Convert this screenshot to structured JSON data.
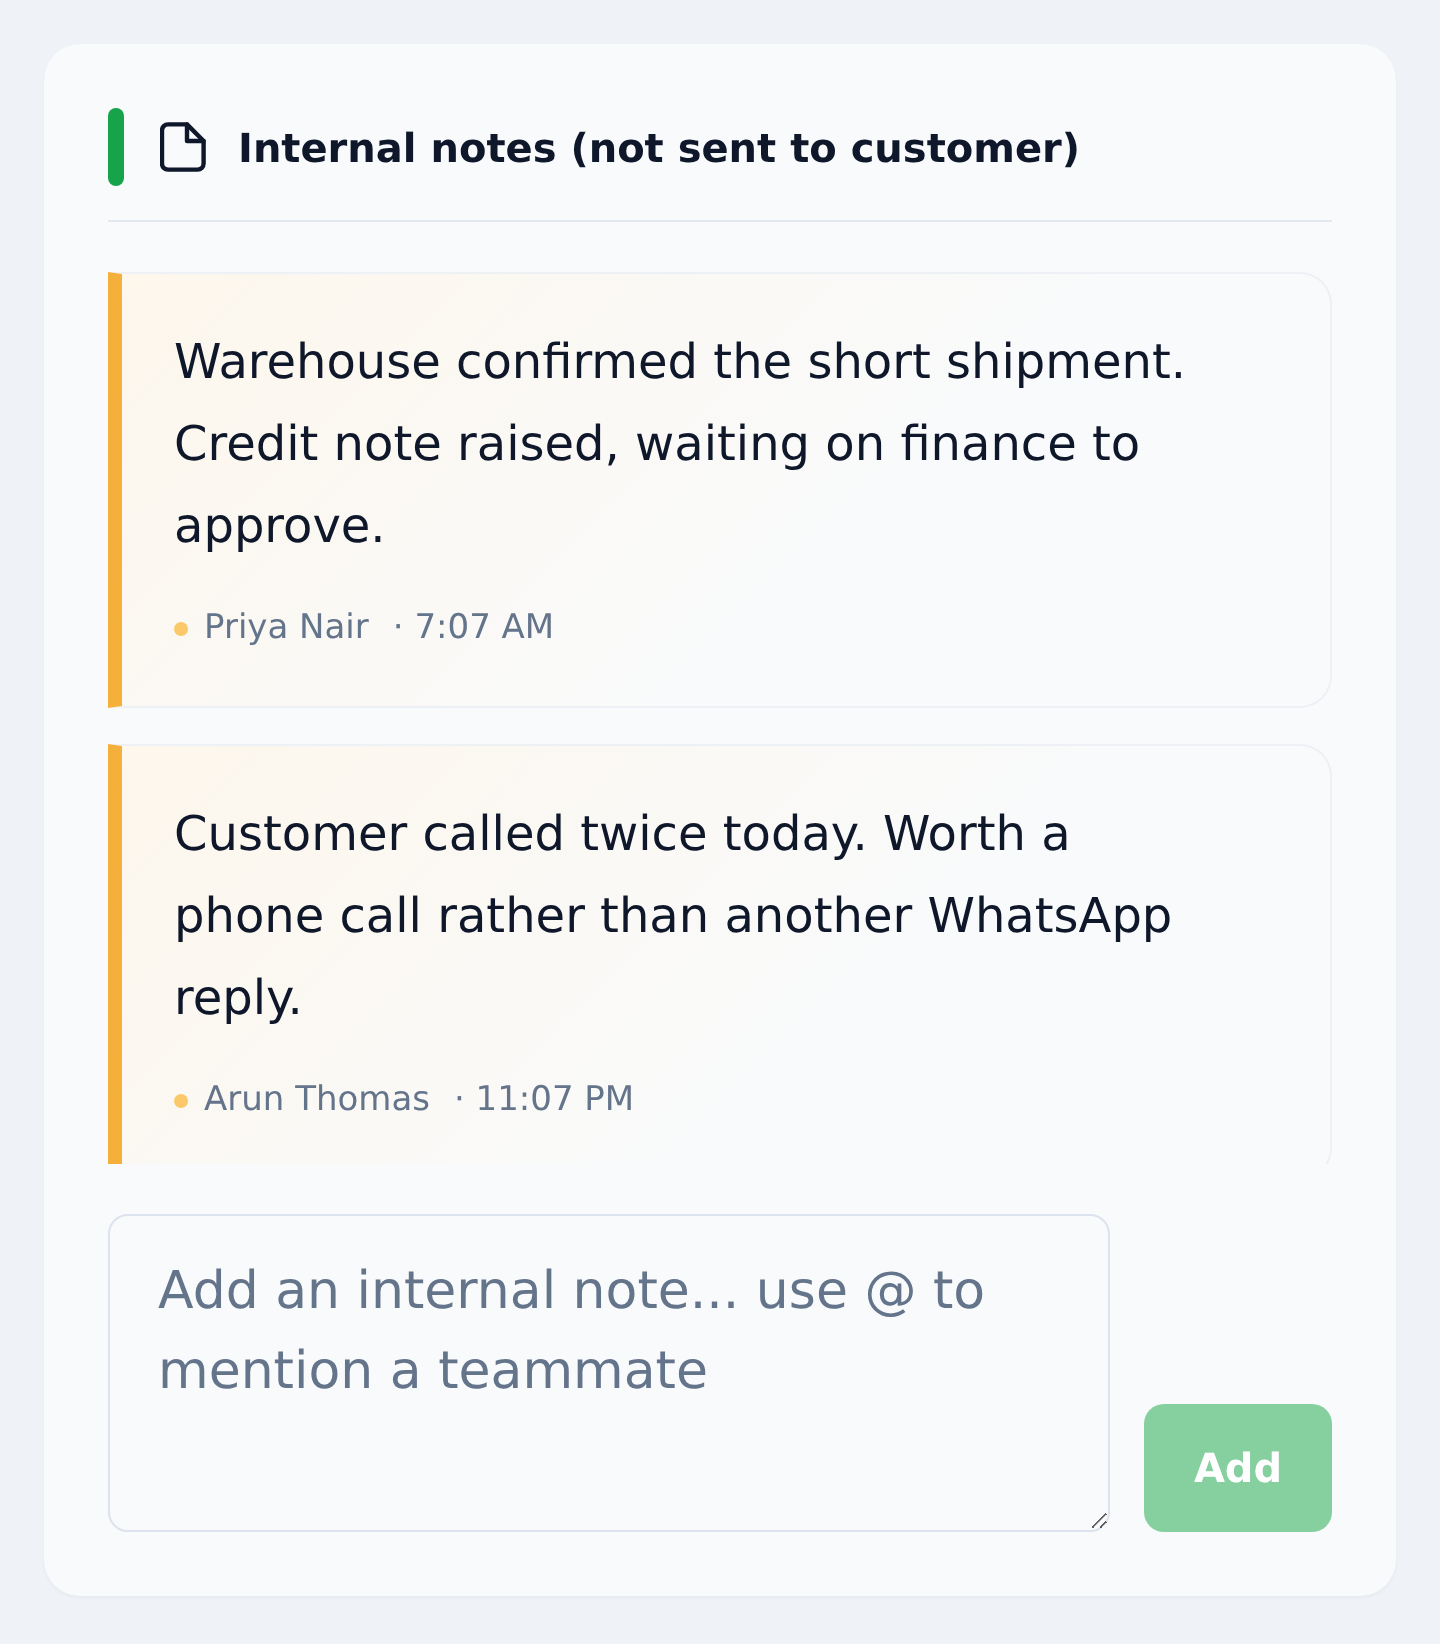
{
  "panel": {
    "title": "Internal notes (not sent to customer)"
  },
  "notes": [
    {
      "text": "Warehouse confirmed the short shipment. Credit note raised, waiting on finance to approve.",
      "author": "Priya Nair",
      "time": "· 7:07 AM"
    },
    {
      "text": "Customer called twice today. Worth a phone call rather than another WhatsApp reply.",
      "author": "Arun Thomas",
      "time": "· 11:07 PM"
    }
  ],
  "composer": {
    "placeholder": "Add an internal note... use @ to mention a teammate",
    "button": {
      "label": "Add",
      "disabled": true
    }
  }
}
